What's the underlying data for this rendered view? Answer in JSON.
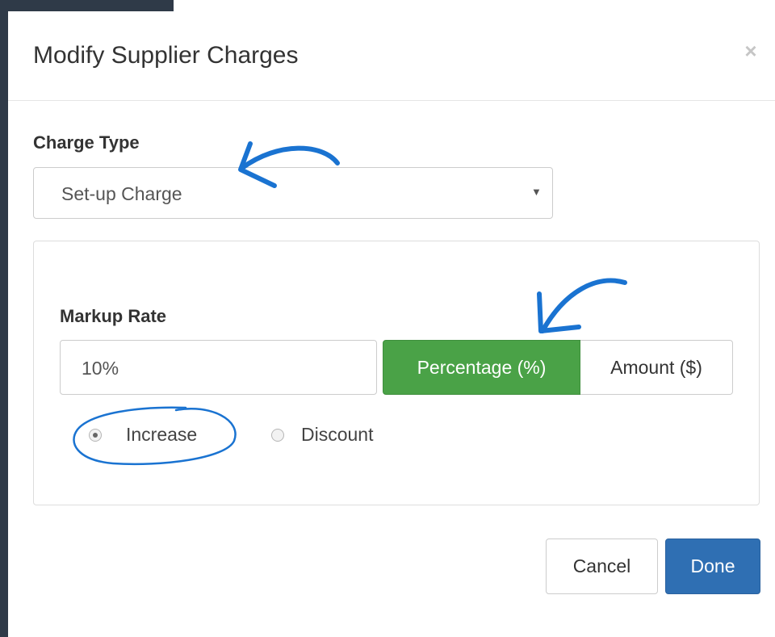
{
  "modal": {
    "title": "Modify Supplier Charges",
    "close_glyph": "×"
  },
  "charge_type": {
    "label": "Charge Type",
    "selected": "Set-up Charge",
    "caret_glyph": "▼"
  },
  "markup": {
    "label": "Markup Rate",
    "value": "10%",
    "units": [
      {
        "label": "Percentage (%)",
        "active": true
      },
      {
        "label": "Amount ($)",
        "active": false
      }
    ],
    "options": [
      {
        "label": "Increase",
        "checked": true
      },
      {
        "label": "Discount",
        "checked": false
      }
    ]
  },
  "footer": {
    "cancel_label": "Cancel",
    "done_label": "Done"
  },
  "colors": {
    "active_unit": "#4aa247",
    "primary": "#2f6fb3",
    "annotation": "#1a73d1"
  },
  "icons": {
    "close": "close-icon",
    "caret": "chevron-down-icon"
  }
}
